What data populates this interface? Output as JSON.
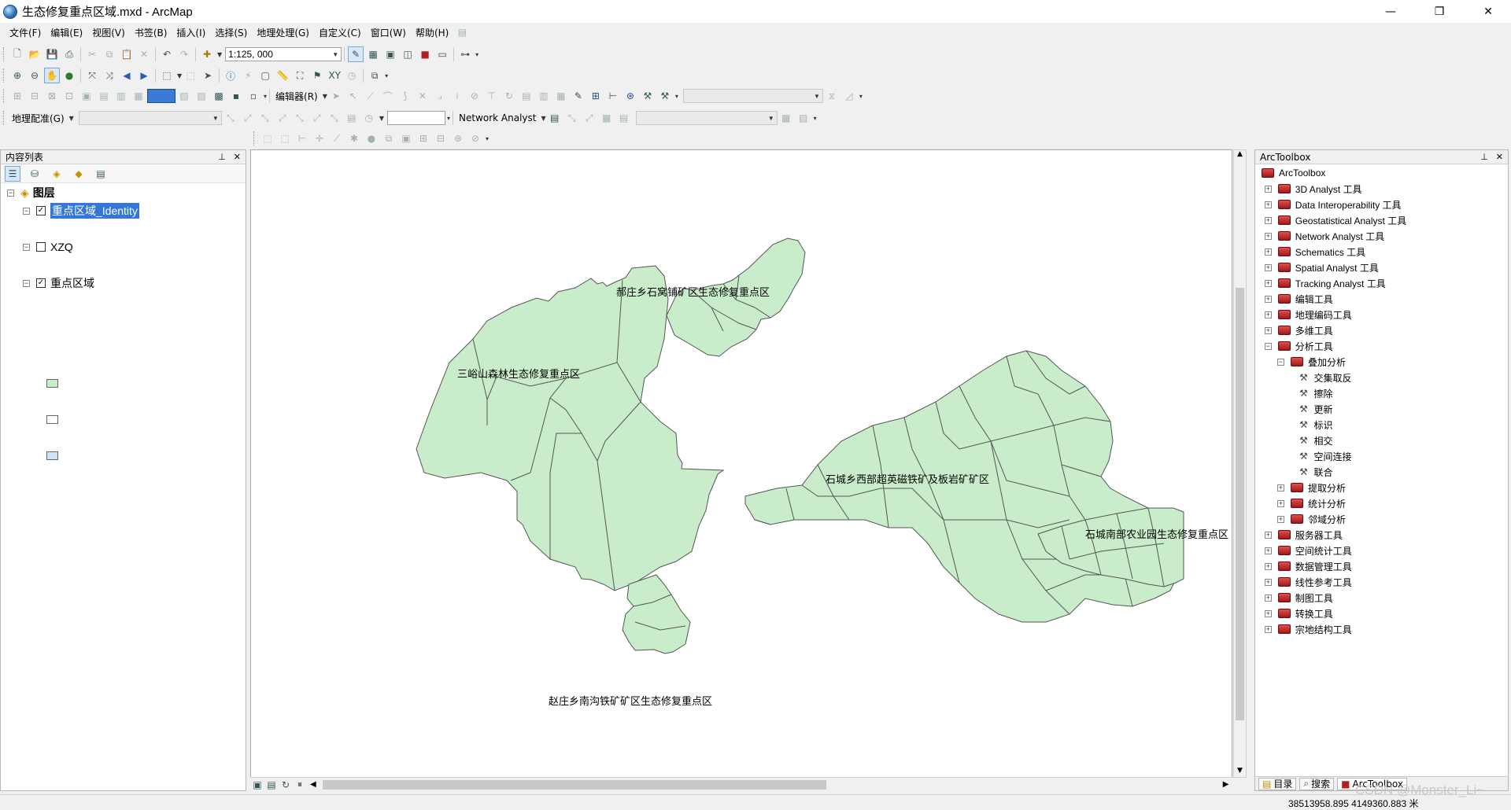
{
  "window": {
    "title": "生态修复重点区域.mxd - ArcMap",
    "minimize": "—",
    "restore": "❐",
    "close": "✕"
  },
  "menus": [
    "文件(F)",
    "编辑(E)",
    "视图(V)",
    "书签(B)",
    "插入(I)",
    "选择(S)",
    "地理处理(G)",
    "自定义(C)",
    "窗口(W)",
    "帮助(H)"
  ],
  "toolbar": {
    "scale": "1:125, 000",
    "editor_label": "编辑器(R)",
    "georef_label": "地理配准(G)",
    "network_analyst_label": "Network Analyst"
  },
  "toc": {
    "title": "内容列表",
    "root": "图层",
    "layers": [
      {
        "name": "重点区域_Identity",
        "checked": true,
        "selected": true,
        "color": "#c9edcb"
      },
      {
        "name": "XZQ",
        "checked": false,
        "selected": false,
        "color": "#ffffff"
      },
      {
        "name": "重点区域",
        "checked": true,
        "selected": false,
        "color": "#cfe4f5"
      }
    ]
  },
  "map": {
    "fill": "#c9edcb",
    "labels": [
      "郝庄乡石窝铺矿区生态修复重点区",
      "三峪山森林生态修复重点区",
      "石城乡西部超英磁铁矿及板岩矿矿区",
      "石城南部农业园生态修复重点区",
      "赵庄乡南沟铁矿矿区生态修复重点区"
    ]
  },
  "arctoolbox": {
    "title": "ArcToolbox",
    "root": "ArcToolbox",
    "toolsets": [
      "3D Analyst 工具",
      "Data Interoperability 工具",
      "Geostatistical Analyst 工具",
      "Network Analyst 工具",
      "Schematics 工具",
      "Spatial Analyst 工具",
      "Tracking Analyst 工具",
      "编辑工具",
      "地理编码工具",
      "多维工具",
      "分析工具"
    ],
    "analysis": {
      "overlay": "叠加分析",
      "overlay_tools": [
        "交集取反",
        "擦除",
        "更新",
        "标识",
        "相交",
        "空间连接",
        "联合"
      ],
      "sub": [
        "提取分析",
        "统计分析",
        "邻域分析"
      ]
    },
    "toolsets_after": [
      "服务器工具",
      "空间统计工具",
      "数据管理工具",
      "线性参考工具",
      "制图工具",
      "转换工具",
      "宗地结构工具"
    ],
    "tabs": [
      "目录",
      "搜索",
      "ArcToolbox"
    ]
  },
  "status": {
    "coords": "38513958.895  4149360.883 米"
  },
  "watermark": "CSDN @Monster_Li~"
}
